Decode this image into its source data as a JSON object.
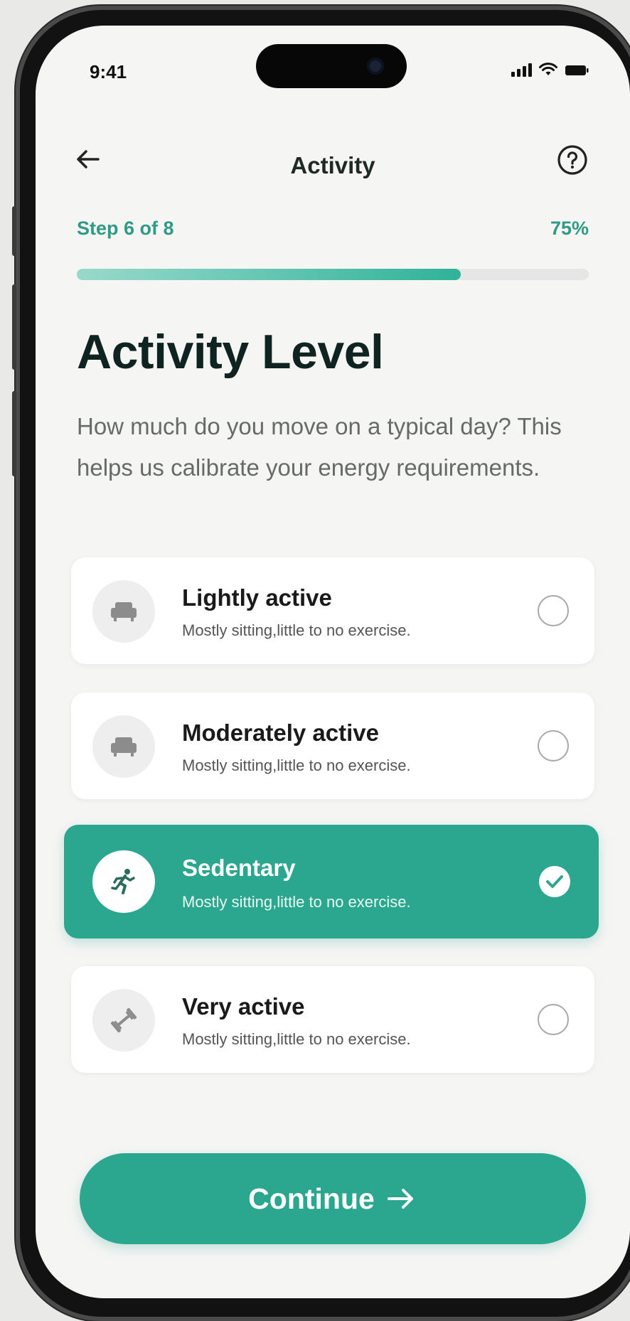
{
  "status_bar": {
    "time": "9:41"
  },
  "nav": {
    "title": "Activity",
    "back_icon": "arrow-left-icon",
    "help_icon": "question-circle-icon"
  },
  "progress": {
    "step_label": "Step 6 of 8",
    "percent_label": "75%",
    "fraction": 0.75
  },
  "heading": "Activity Level",
  "description": "How much do you move on a typical day? This helps us calibrate your energy requirements.",
  "options": [
    {
      "title": "Lightly active",
      "subtitle": "Mostly sitting,little to no exercise.",
      "icon": "couch-icon",
      "selected": false
    },
    {
      "title": "Moderately active",
      "subtitle": "Mostly sitting,little to no exercise.",
      "icon": "couch-icon",
      "selected": false
    },
    {
      "title": "Sedentary",
      "subtitle": "Mostly sitting,little to no exercise.",
      "icon": "running-person-icon",
      "selected": true
    },
    {
      "title": "Very active",
      "subtitle": "Mostly sitting,little to no exercise.",
      "icon": "dumbbell-icon",
      "selected": false
    }
  ],
  "continue_button": {
    "label": "Continue",
    "icon": "arrow-right-icon"
  },
  "colors": {
    "accent": "#2ba68f",
    "accent_text": "#2f9b87",
    "heading": "#0f2420",
    "body_text": "#666a69"
  }
}
